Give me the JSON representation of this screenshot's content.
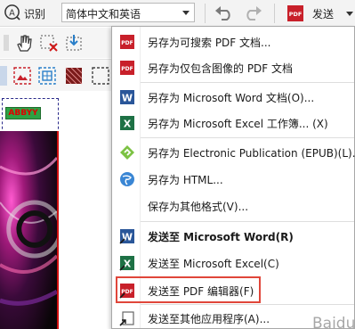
{
  "toolbar": {
    "recognize_label": "识别",
    "language_value": "简体中文和英语",
    "send_label": "发送",
    "icons": [
      "recognize-icon",
      "undo-icon",
      "redo-icon",
      "pdf-icon",
      "chevron-down-icon"
    ]
  },
  "menu": {
    "items": [
      {
        "label": "另存为可搜索 PDF 文档...",
        "icon": "pdf-icon"
      },
      {
        "label": "另存为仅包含图像的 PDF 文档",
        "icon": "pdf-icon"
      },
      {
        "label": "另存为 Microsoft Word 文档(O)...",
        "icon": "word-icon"
      },
      {
        "label": "另存为 Microsoft Excel 工作簿... (X)",
        "icon": "excel-icon"
      },
      {
        "label": "另存为 Electronic Publication (EPUB)(L)...",
        "icon": "epub-icon"
      },
      {
        "label": "另存为 HTML...",
        "icon": "html-icon"
      },
      {
        "label": "保存为其他格式(V)...",
        "icon": ""
      },
      {
        "label": "发送至 Microsoft Word(R)",
        "icon": "word-icon"
      },
      {
        "label": "发送至 Microsoft Excel(C)",
        "icon": "excel-icon"
      },
      {
        "label": "发送至 PDF 编辑器(F)",
        "icon": "pdf-icon"
      },
      {
        "label": "发送至其他应用程序(A)...",
        "icon": "send-icon"
      }
    ]
  },
  "image": {
    "logo_text": "ABBYY"
  },
  "watermark": {
    "text": "Baidu经验"
  },
  "colors": {
    "pdf_red": "#c8202a",
    "word_blue": "#2a5699",
    "excel_green": "#1e7145",
    "epub_green": "#7cc243",
    "highlight": "#e0463a"
  }
}
